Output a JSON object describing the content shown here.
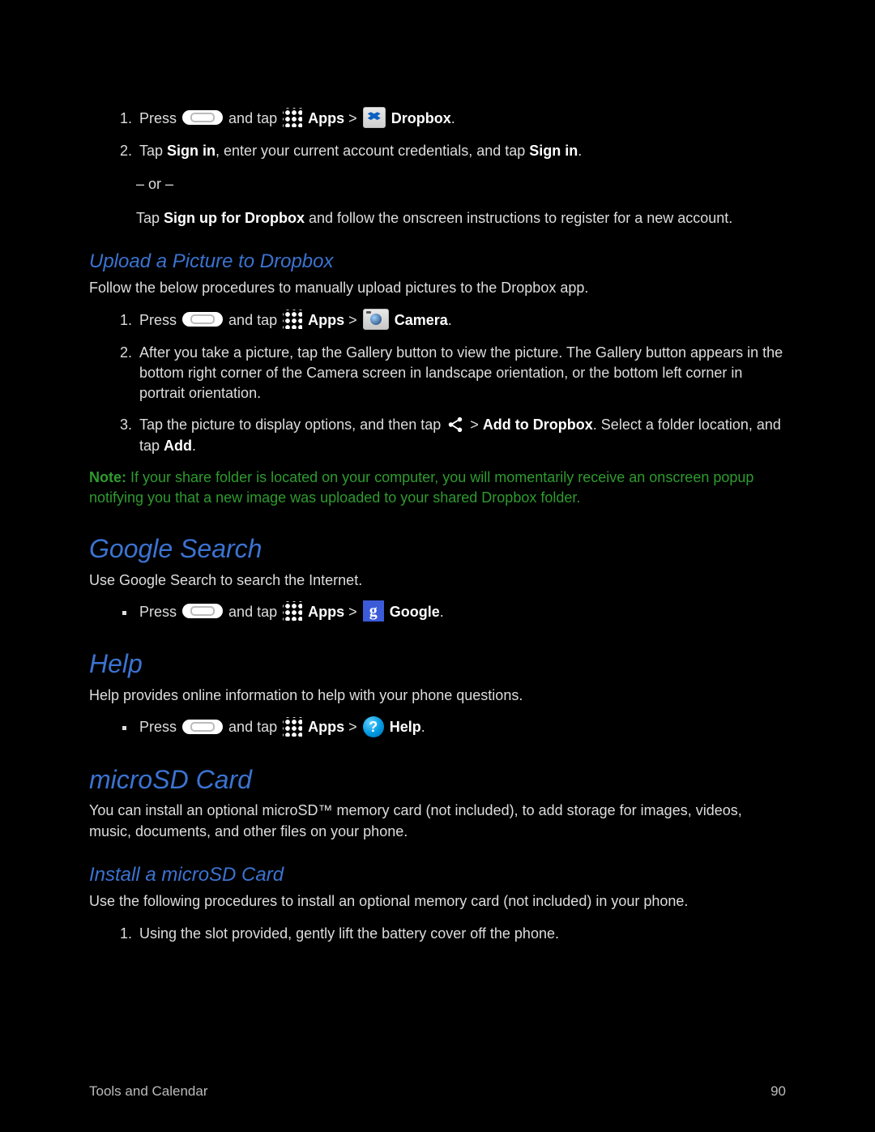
{
  "common": {
    "press": "Press",
    "and_tap": "and tap",
    "apps": "Apps",
    "greater": ">"
  },
  "dropbox_section": {
    "target_app": "Dropbox",
    "step2": {
      "a": "Tap ",
      "b": "Sign in",
      "c": ", enter your current account credentials, and tap ",
      "d": "Sign in",
      "e": "."
    },
    "or": "– or –",
    "alt": {
      "a": "Tap ",
      "b": "Sign up for Dropbox",
      "c": " and follow the onscreen instructions to register for a new account."
    }
  },
  "upload": {
    "heading": "Upload a Picture to Dropbox",
    "intro": "Follow the below procedures to manually upload pictures to the Dropbox app.",
    "target_app": "Camera",
    "step2": "After you take a picture, tap the Gallery button to view the picture. The Gallery button appears in the bottom right corner of the Camera screen in landscape orientation, or the bottom left corner in portrait orientation.",
    "step3": {
      "a": "Tap the picture to display options, and then tap ",
      "b": "Add to Dropbox",
      "c": ". Select a folder location, and tap ",
      "d": "Add",
      "e": "."
    },
    "note": {
      "label": "Note:",
      "text": " If your share folder is located on your computer, you will momentarily receive an onscreen popup notifying you that a new image was uploaded to your shared Dropbox folder."
    }
  },
  "gsearch": {
    "heading": "Google Search",
    "intro": "Use Google Search to search the Internet.",
    "target_app": "Google"
  },
  "help": {
    "heading": "Help",
    "intro": "Help provides online information to help with your phone questions.",
    "target_app": "Help"
  },
  "microsd": {
    "heading": "microSD Card",
    "intro": "You can install an optional microSD™ memory card (not included), to add storage for images, videos, music, documents, and other files on your phone.",
    "install_heading": "Install a microSD Card",
    "install_intro": "Use the following procedures to install an optional memory card (not included) in your phone.",
    "step1": "Using the slot provided, gently lift the battery cover off the phone."
  },
  "footer": {
    "section": "Tools and Calendar",
    "page": "90"
  },
  "glyphs": {
    "g": "g",
    "q": "?"
  }
}
